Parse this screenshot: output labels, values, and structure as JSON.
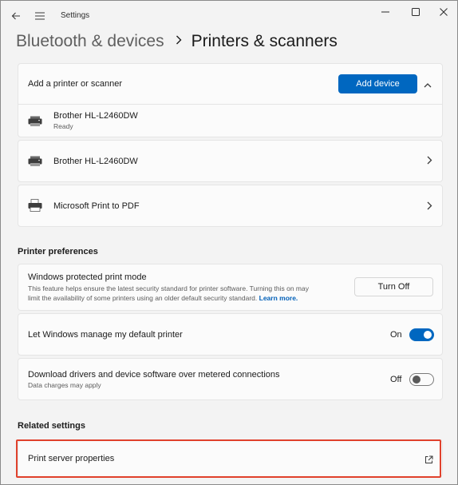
{
  "window": {
    "app_title": "Settings",
    "icons": {
      "back": "back-arrow-icon",
      "menu": "hamburger-menu-icon",
      "minimize": "minimize-icon",
      "maximize": "maximize-icon",
      "close": "close-icon"
    }
  },
  "breadcrumb": {
    "parent": "Bluetooth & devices",
    "current": "Printers & scanners"
  },
  "add_printer": {
    "label": "Add a printer or scanner",
    "button_label": "Add device",
    "expanded": true
  },
  "printers": [
    {
      "name": "Brother HL-L2460DW",
      "status": "Ready"
    },
    {
      "name": "Brother HL-L2460DW",
      "status": ""
    },
    {
      "name": "Microsoft Print to PDF",
      "status": ""
    }
  ],
  "printer_preferences": {
    "title": "Printer preferences",
    "protected_mode": {
      "label": "Windows protected print mode",
      "description_line1": "This feature helps ensure the latest security standard for printer software. Turning this on may",
      "description_line2": "limit the availability of some printers using an older default security standard.",
      "link": "Learn more.",
      "button_label": "Turn Off"
    },
    "default_printer": {
      "label": "Let Windows manage my default printer",
      "state": "On",
      "on": true
    },
    "metered": {
      "label": "Download drivers and device software over metered connections",
      "description": "Data charges may apply",
      "state": "Off",
      "on": false
    }
  },
  "related_settings": {
    "title": "Related settings",
    "print_server": {
      "label": "Print server properties"
    }
  },
  "colors": {
    "accent": "#0067c0",
    "highlight_border": "#e0412c"
  }
}
